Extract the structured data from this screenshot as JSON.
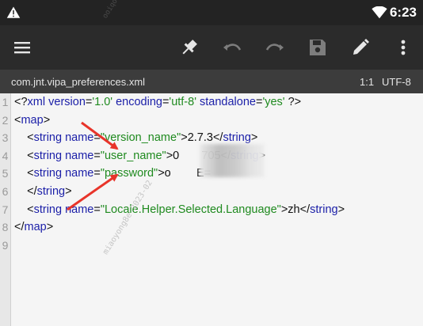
{
  "status_bar": {
    "warning_icon": "warning-triangle-icon",
    "wifi_icon": "wifi-icon",
    "battery_icon": "battery-icon",
    "time": "6:23"
  },
  "toolbar": {
    "menu_icon": "hamburger-menu-icon",
    "pin_icon": "pin-icon",
    "undo_icon": "undo-icon",
    "redo_icon": "redo-icon",
    "save_icon": "save-icon",
    "edit_icon": "pencil-icon",
    "more_icon": "more-vert-icon"
  },
  "file_bar": {
    "filename": "com.jnt.vipa_preferences.xml",
    "cursor_position": "1:1",
    "encoding": "UTF-8"
  },
  "editor": {
    "line_numbers": [
      "1",
      "2",
      "3",
      "4",
      "5",
      "6",
      "7",
      "8",
      "9"
    ],
    "lines": [
      [
        {
          "t": "<?",
          "c": "t-punct"
        },
        {
          "t": "xml",
          "c": "t-tag"
        },
        {
          "t": " ",
          "c": "t-punct"
        },
        {
          "t": "version",
          "c": "t-attr"
        },
        {
          "t": "=",
          "c": "t-punct"
        },
        {
          "t": "'1.0'",
          "c": "t-val"
        },
        {
          "t": " ",
          "c": "t-punct"
        },
        {
          "t": "encoding",
          "c": "t-attr"
        },
        {
          "t": "=",
          "c": "t-punct"
        },
        {
          "t": "'utf-8'",
          "c": "t-val"
        },
        {
          "t": " ",
          "c": "t-punct"
        },
        {
          "t": "standalone",
          "c": "t-attr"
        },
        {
          "t": "=",
          "c": "t-punct"
        },
        {
          "t": "'yes'",
          "c": "t-val"
        },
        {
          "t": " ?>",
          "c": "t-punct"
        }
      ],
      [
        {
          "t": "<",
          "c": "t-punct"
        },
        {
          "t": "map",
          "c": "t-tag"
        },
        {
          "t": ">",
          "c": "t-punct"
        }
      ],
      [
        {
          "t": "    <",
          "c": "t-punct"
        },
        {
          "t": "string",
          "c": "t-tag"
        },
        {
          "t": " ",
          "c": "t-punct"
        },
        {
          "t": "name",
          "c": "t-attr"
        },
        {
          "t": "=",
          "c": "t-punct"
        },
        {
          "t": "\"version_name\"",
          "c": "t-val"
        },
        {
          "t": ">",
          "c": "t-punct"
        },
        {
          "t": "2.7.3",
          "c": "t-text"
        },
        {
          "t": "</",
          "c": "t-punct"
        },
        {
          "t": "string",
          "c": "t-tag"
        },
        {
          "t": ">",
          "c": "t-punct"
        }
      ],
      [
        {
          "t": "    <",
          "c": "t-punct"
        },
        {
          "t": "string",
          "c": "t-tag"
        },
        {
          "t": " ",
          "c": "t-punct"
        },
        {
          "t": "name",
          "c": "t-attr"
        },
        {
          "t": "=",
          "c": "t-punct"
        },
        {
          "t": "\"user_name\"",
          "c": "t-val"
        },
        {
          "t": ">",
          "c": "t-punct"
        },
        {
          "t": "0       705",
          "c": "t-text"
        },
        {
          "t": "</",
          "c": "t-punct"
        },
        {
          "t": "string",
          "c": "t-tag"
        },
        {
          "t": ">",
          "c": "t-punct"
        }
      ],
      [
        {
          "t": "    <",
          "c": "t-punct"
        },
        {
          "t": "string",
          "c": "t-tag"
        },
        {
          "t": " ",
          "c": "t-punct"
        },
        {
          "t": "name",
          "c": "t-attr"
        },
        {
          "t": "=",
          "c": "t-punct"
        },
        {
          "t": "\"password\"",
          "c": "t-val"
        },
        {
          "t": ">",
          "c": "t-punct"
        },
        {
          "t": "o        E=",
          "c": "t-text"
        }
      ],
      [
        {
          "t": "    </",
          "c": "t-punct"
        },
        {
          "t": "string",
          "c": "t-tag"
        },
        {
          "t": ">",
          "c": "t-punct"
        }
      ],
      [
        {
          "t": "    <",
          "c": "t-punct"
        },
        {
          "t": "string",
          "c": "t-tag"
        },
        {
          "t": " ",
          "c": "t-punct"
        },
        {
          "t": "name",
          "c": "t-attr"
        },
        {
          "t": "=",
          "c": "t-punct"
        },
        {
          "t": "\"Locale.Helper.Selected.Language\"",
          "c": "t-val"
        },
        {
          "t": ">",
          "c": "t-punct"
        },
        {
          "t": "zh",
          "c": "t-text"
        },
        {
          "t": "</",
          "c": "t-punct"
        },
        {
          "t": "string",
          "c": "t-tag"
        },
        {
          "t": ">",
          "c": "t-punct"
        }
      ],
      [
        {
          "t": "</",
          "c": "t-punct"
        },
        {
          "t": "map",
          "c": "t-tag"
        },
        {
          "t": ">",
          "c": "t-punct"
        }
      ],
      []
    ]
  },
  "watermarks": [
    "miaoyong8e    2023-02",
    "ooiqoe"
  ],
  "colors": {
    "status_bg": "#232323",
    "toolbar_bg": "#2b2b2b",
    "filebar_bg": "#3c3c3c",
    "editor_bg": "#f5f5f5",
    "tag_color": "#1b1fa8",
    "value_color": "#1f8a1f",
    "annotation_arrow": "#e8342a"
  }
}
